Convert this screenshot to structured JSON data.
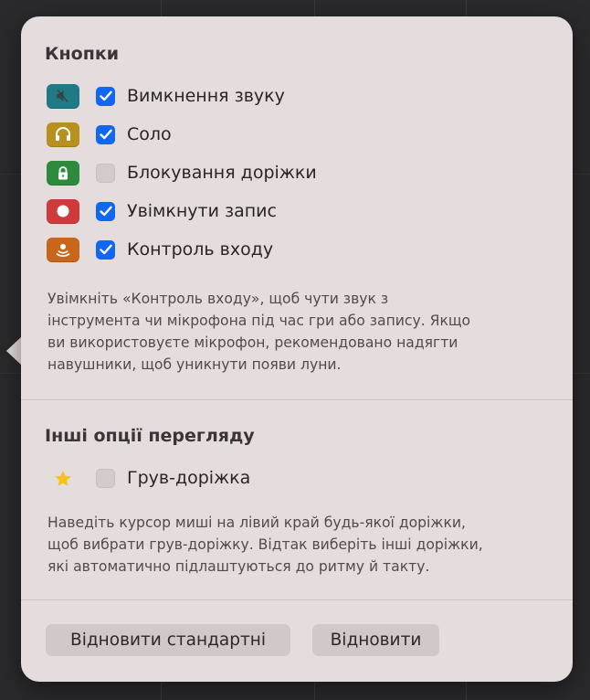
{
  "buttons_section": {
    "title": "Кнопки",
    "items": [
      {
        "label": "Вимкнення звуку",
        "checked": true,
        "icon": "speaker-muted-icon",
        "color": "#1f7a86"
      },
      {
        "label": "Соло",
        "checked": true,
        "icon": "headphones-icon",
        "color": "#b8901e"
      },
      {
        "label": "Блокування доріжки",
        "checked": false,
        "icon": "lock-icon",
        "color": "#2e8a3c"
      },
      {
        "label": "Увімкнути запис",
        "checked": true,
        "icon": "record-icon",
        "color": "#cf3b3b"
      },
      {
        "label": "Контроль входу",
        "checked": true,
        "icon": "input-monitoring-icon",
        "color": "#c8671c"
      }
    ],
    "description": "Увімкніть «Контроль входу», щоб чути звук з\nінструмента чи мікрофона під час гри або запису. Якщо\nви використовуєте мікрофон, рекомендовано надягти\nнавушники, щоб уникнути появи луни."
  },
  "other_section": {
    "title": "Інші опції перегляду",
    "groove": {
      "label": "Грув-доріжка",
      "checked": false,
      "icon": "star-icon",
      "color": "#f6c21b"
    },
    "description": "Наведіть курсор миші на лівий край будь-якої доріжки,\nщоб вибрати грув-доріжку. Відтак виберіть інші доріжки,\nякі автоматично підлаштуються до ритму й такту."
  },
  "footer": {
    "restore_defaults_label": "Відновити стандартні",
    "restore_label": "Відновити"
  },
  "colors": {
    "checkbox_accent": "#1166f2",
    "popover_background": "#e4dcdd"
  }
}
